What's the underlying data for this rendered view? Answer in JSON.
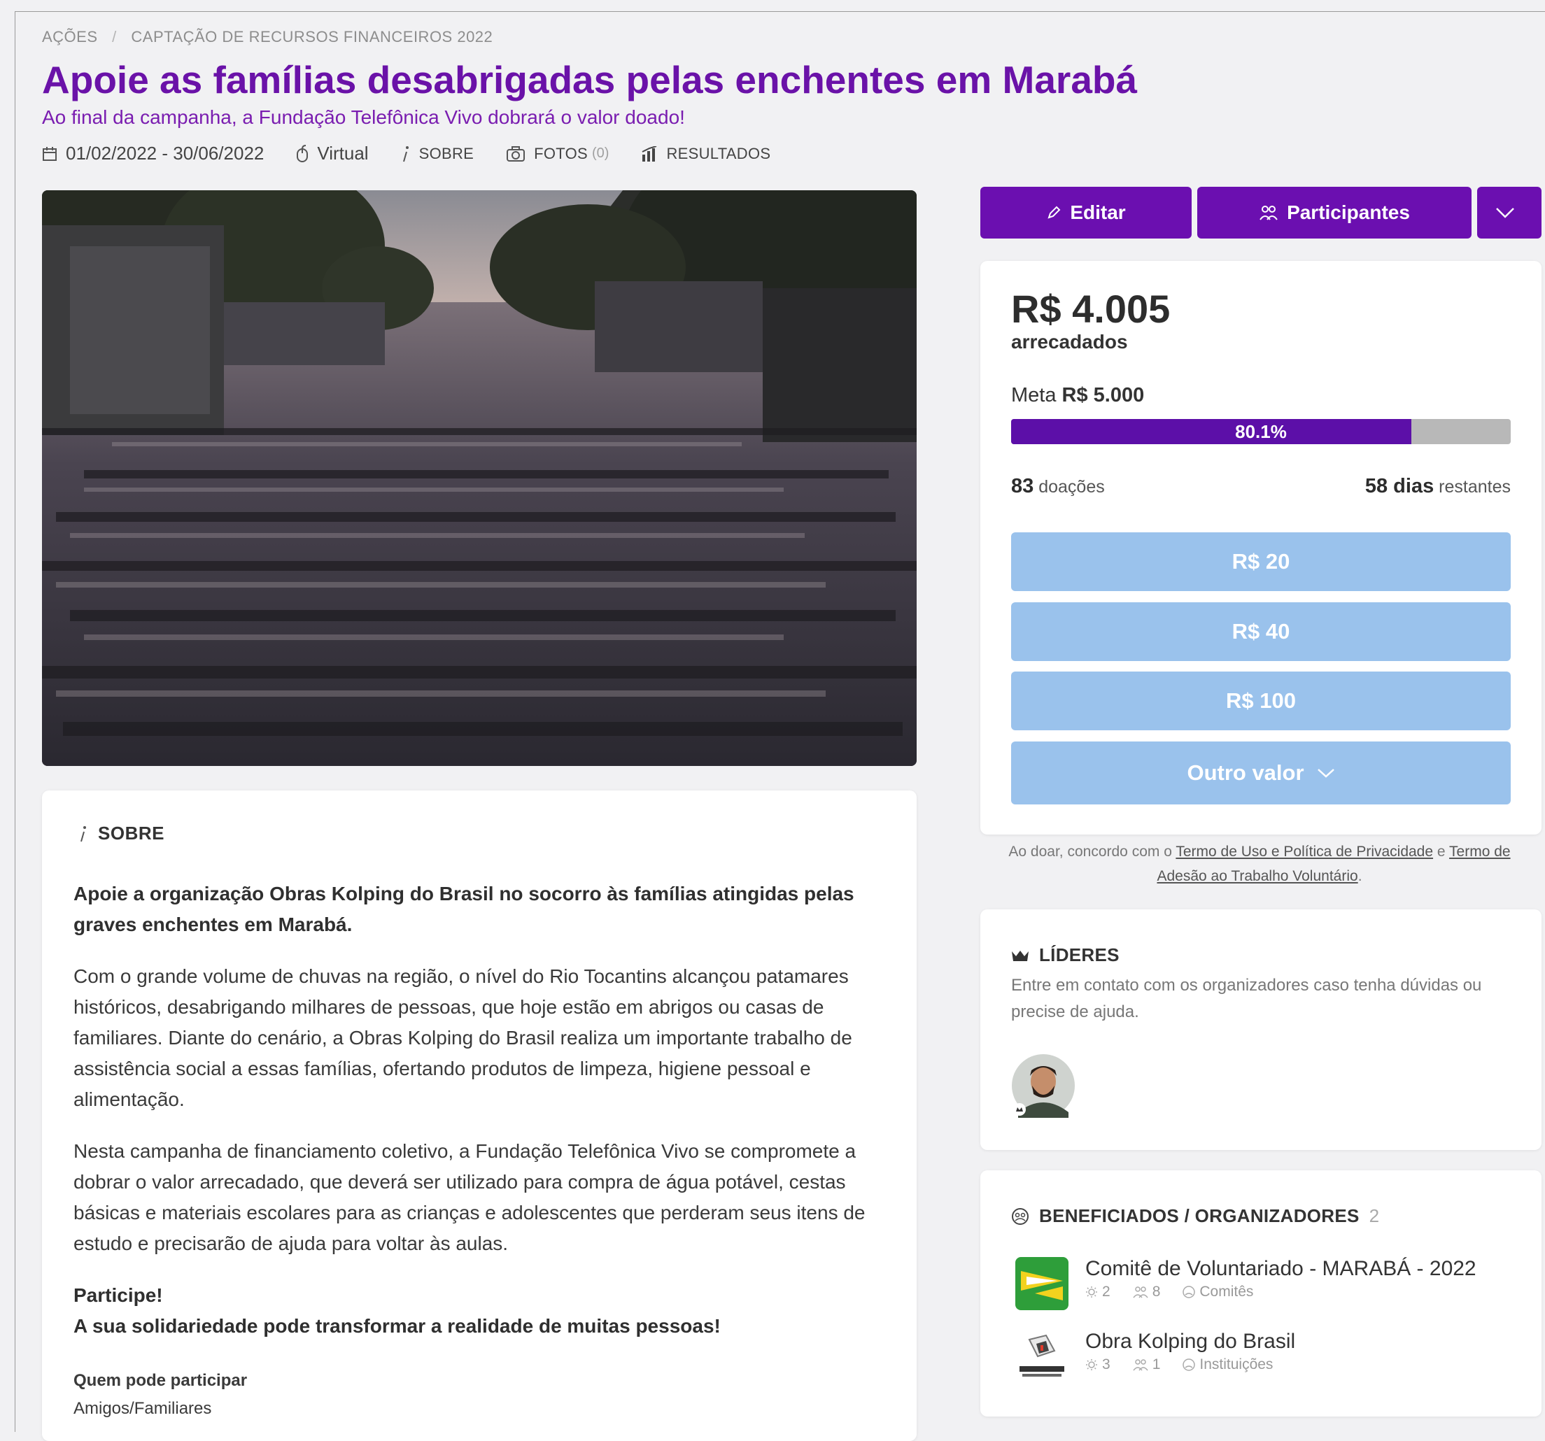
{
  "breadcrumb": {
    "root": "AÇÕES",
    "separator": "/",
    "current": "CAPTAÇÃO DE RECURSOS FINANCEIROS 2022"
  },
  "campaign": {
    "title": "Apoie as famílias desabrigadas pelas enchentes em Marabá",
    "subtitle": "Ao final da campanha, a Fundação Telefônica Vivo dobrará o valor doado!"
  },
  "meta": {
    "dates": "01/02/2022 - 30/06/2022",
    "location": "Virtual",
    "about_link": "SOBRE",
    "photos_link": "FOTOS",
    "photos_count": "(0)",
    "results_link": "RESULTADOS"
  },
  "about": {
    "heading": "SOBRE",
    "lead": "Apoie a organização Obras Kolping do Brasil no socorro às famílias atingidas pelas graves enchentes em Marabá.",
    "p1": "Com o grande volume de chuvas na região, o nível do Rio Tocantins alcançou patamares históricos, desabrigando milhares de pessoas, que hoje estão em abrigos ou casas de familiares. Diante do cenário, a Obras Kolping do Brasil realiza um importante trabalho de assistência social a essas famílias, ofertando produtos de limpeza, higiene pessoal e alimentação.",
    "p2": "Nesta campanha de financiamento coletivo, a Fundação Telefônica Vivo se compromete a dobrar o valor arrecadado, que deverá ser utilizado para compra de água potável, cestas básicas e materiais escolares para as crianças e adolescentes que perderam seus itens de estudo e precisarão de ajuda para voltar às aulas.",
    "cta1": "Participe!",
    "cta2": "A sua solidariedade pode transformar a realidade de muitas pessoas!",
    "who_label": "Quem pode participar",
    "who_value": "Amigos/Familiares"
  },
  "actions": {
    "edit": "Editar",
    "participants": "Participantes"
  },
  "donation": {
    "raised": "R$ 4.005",
    "raised_label": "arrecadados",
    "goal_label": "Meta",
    "goal_value": "R$ 5.000",
    "progress_label": "80.1%",
    "progress_fraction": 0.801,
    "donations_count": "83",
    "donations_label": "doações",
    "days_left": "58 dias",
    "days_label": "restantes",
    "amounts": [
      "R$ 20",
      "R$ 40",
      "R$ 100"
    ],
    "other_value": "Outro valor"
  },
  "terms": {
    "prefix": "Ao doar, concordo com o",
    "link1": "Termo de Uso e Política de Privacidade",
    "conj": "e",
    "link2": "Termo de Adesão ao Trabalho Voluntário",
    "suffix": "."
  },
  "leaders": {
    "heading": "LÍDERES",
    "text": "Entre em contato com os organizadores caso tenha dúvidas ou precise de ajuda."
  },
  "beneficiaries": {
    "heading": "BENEFICIADOS / ORGANIZADORES",
    "count": "2",
    "items": [
      {
        "name": "Comitê de Voluntariado - MARABÁ - 2022",
        "actions": "2",
        "people": "8",
        "type": "Comitês"
      },
      {
        "name": "Obra Kolping do Brasil",
        "actions": "3",
        "people": "1",
        "type": "Instituições"
      }
    ]
  },
  "colors": {
    "brand": "#6b0fb0",
    "progress": "#5c0fa8",
    "amount_button": "#9ac2ec"
  }
}
